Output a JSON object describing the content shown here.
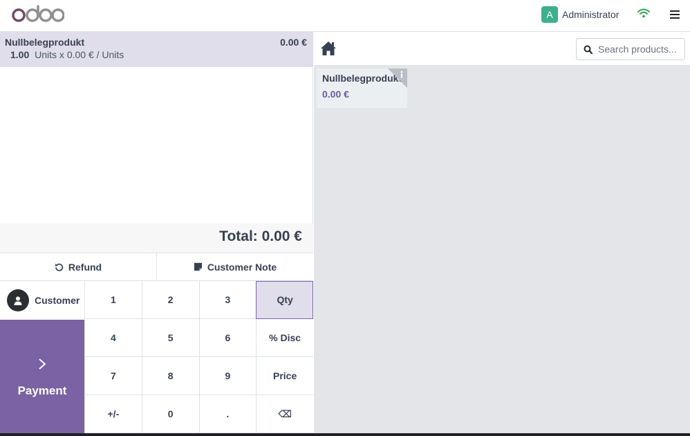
{
  "header": {
    "logo_text": "odoo",
    "user_initial": "A",
    "user_name": "Administrator"
  },
  "order": {
    "lines": [
      {
        "name": "Nullbelegprodukt",
        "price": "0.00 €",
        "qty": "1.00",
        "unit_detail": "Units x 0.00 € / Units"
      }
    ],
    "total": "Total: 0.00 €"
  },
  "controls": {
    "refund_label": "Refund",
    "note_label": "Customer Note",
    "customer_label": "Customer",
    "payment_label": "Payment"
  },
  "numpad": {
    "keys": [
      "1",
      "2",
      "3",
      "Qty",
      "4",
      "5",
      "6",
      "% Disc",
      "7",
      "8",
      "9",
      "Price",
      "+/-",
      "0",
      ".",
      "⌫"
    ],
    "active_mode": "Qty"
  },
  "products": {
    "search_placeholder": "Search products...",
    "items": [
      {
        "name": "Nullbelegprodukt",
        "price": "0.00 €"
      }
    ]
  },
  "icons": [
    "home-icon",
    "search-icon",
    "refund-icon",
    "note-icon",
    "user-icon",
    "chevron-right-icon",
    "wifi-icon",
    "menu-icon",
    "info-icon"
  ],
  "colors": {
    "brand": "#714b67",
    "accent": "#7a62a4",
    "selected_line": "#e0deeb",
    "wifi_online": "#28a745",
    "avatar": "#3bb08f"
  }
}
